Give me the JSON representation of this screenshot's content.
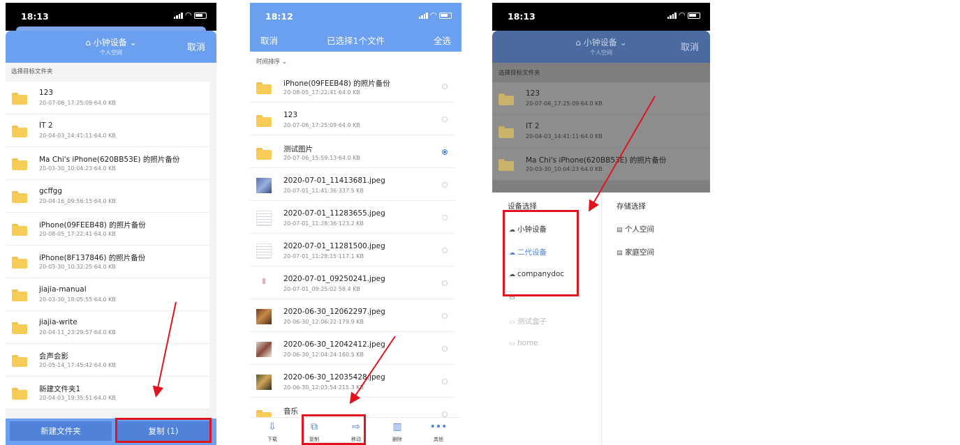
{
  "colors": {
    "accent": "#6b9ff0",
    "button": "#4f82d8",
    "annotation_red": "#e0141f",
    "folder": "#f7cd57"
  },
  "phone1": {
    "time": "18:13",
    "device_title": "⌂ 小钟设备 ⌄",
    "device_subtitle": "个人空间",
    "cancel": "取消",
    "section_label": "选择目标文件夹",
    "folders": [
      {
        "name": "123",
        "meta": "20-07-06_17:25:09·64.0 KB"
      },
      {
        "name": "IT 2",
        "meta": "20-04-03_14:41:11·64.0 KB"
      },
      {
        "name": "Ma Chi's iPhone(620BB53E) 的照片备份",
        "meta": "20-03-30_10:04:23·64.0 KB"
      },
      {
        "name": "gcffgg",
        "meta": "20-04-16_09:56:15·64.0 KB"
      },
      {
        "name": "iPhone(09FEEB48) 的照片备份",
        "meta": "20-08-05_17:22:41·64.0 KB"
      },
      {
        "name": "iPhone(8F137846) 的照片备份",
        "meta": "20-03-30_10:32:25·64.0 KB"
      },
      {
        "name": "jiajia-manual",
        "meta": "20-03-30_18:05:55·64.0 KB"
      },
      {
        "name": "jiajia-write",
        "meta": "20-04-11_23:29:57·64.0 KB"
      },
      {
        "name": "会声会影",
        "meta": "20-05-14_17:45:42·64.0 KB"
      },
      {
        "name": "新建文件夹1",
        "meta": "20-04-03_19:35:51·64.0 KB"
      }
    ],
    "btn_new_folder": "新建文件夹",
    "btn_copy": "复制 (1)"
  },
  "phone2": {
    "time": "18:12",
    "nav_cancel": "取消",
    "nav_title": "已选择1个文件",
    "nav_select_all": "全选",
    "sort_label": "时间排序 ⌄",
    "files": [
      {
        "name": "iPhone(09FEEB48) 的照片备份",
        "meta": "20-08-05_17:22:41·64.0 KB",
        "icon": "folder-icon",
        "selected": false
      },
      {
        "name": "123",
        "meta": "20-07-06_17:25:09·64.0 KB",
        "icon": "folder-icon",
        "selected": false
      },
      {
        "name": "测试图片",
        "meta": "20-07-06_15:59:13·64.0 KB",
        "icon": "folder-icon",
        "selected": true
      },
      {
        "name": "2020-07-01_11413681.jpeg",
        "meta": "20-07-01_11:41:36·337.5 KB",
        "icon": "image-thumbnail",
        "selected": false
      },
      {
        "name": "2020-07-01_11283655.jpeg",
        "meta": "20-07-01_11:28:36·123.2 KB",
        "icon": "image-thumbnail",
        "selected": false
      },
      {
        "name": "2020-07-01_11281500.jpeg",
        "meta": "20-07-01_11:28:15·117.1 KB",
        "icon": "image-thumbnail",
        "selected": false
      },
      {
        "name": "2020-07-01_09250241.jpeg",
        "meta": "20-07-01_09:25:02·58.4 KB",
        "icon": "image-thumbnail",
        "selected": false
      },
      {
        "name": "2020-06-30_12062297.jpeg",
        "meta": "20-06-30_12:06:22·179.9 KB",
        "icon": "image-thumbnail",
        "selected": false
      },
      {
        "name": "2020-06-30_12042412.jpeg",
        "meta": "20-06-30_12:04:24·160.5 KB",
        "icon": "image-thumbnail",
        "selected": false
      },
      {
        "name": "2020-06-30_12035428.jpeg",
        "meta": "20-06-30_12:03:54·215.3 KB",
        "icon": "image-thumbnail",
        "selected": false
      },
      {
        "name": "音乐",
        "meta": "",
        "icon": "folder-icon",
        "selected": false
      }
    ],
    "toolbar": [
      {
        "label": "下载",
        "icon": "download-icon"
      },
      {
        "label": "复制",
        "icon": "copy-icon"
      },
      {
        "label": "移动",
        "icon": "move-icon"
      },
      {
        "label": "删除",
        "icon": "trash-icon"
      },
      {
        "label": "其他",
        "icon": "more-icon"
      }
    ]
  },
  "phone3": {
    "time": "18:13",
    "device_title": "⌂ 小钟设备 ⌄",
    "device_subtitle": "个人空间",
    "cancel": "取消",
    "section_label": "选择目标文件夹",
    "folders": [
      {
        "name": "123",
        "meta": "20-07-06_17:25:09·64.0 KB"
      },
      {
        "name": "IT 2",
        "meta": "20-04-03_14:41:11·64.0 KB"
      },
      {
        "name": "Ma Chi's iPhone(620BB53E) 的照片备份",
        "meta": "20-03-30_10:04:23·64.0 KB"
      }
    ],
    "device_header": "设备选择",
    "storage_header": "存储选择",
    "devices": [
      {
        "name": "小钟设备",
        "icon": "cloud-icon",
        "state": "normal"
      },
      {
        "name": "二代设备",
        "icon": "cloud-icon",
        "state": "active"
      },
      {
        "name": "companydoc",
        "icon": "cloud-icon",
        "state": "normal"
      },
      {
        "name": "",
        "icon": "monitor-icon",
        "state": "faded"
      },
      {
        "name": "测试盒子",
        "icon": "monitor-icon",
        "state": "dim"
      },
      {
        "name": "home",
        "icon": "monitor-icon",
        "state": "dim"
      }
    ],
    "storages": [
      {
        "name": "个人空间",
        "icon": "storage-icon"
      },
      {
        "name": "家庭空间",
        "icon": "storage-icon"
      }
    ]
  }
}
